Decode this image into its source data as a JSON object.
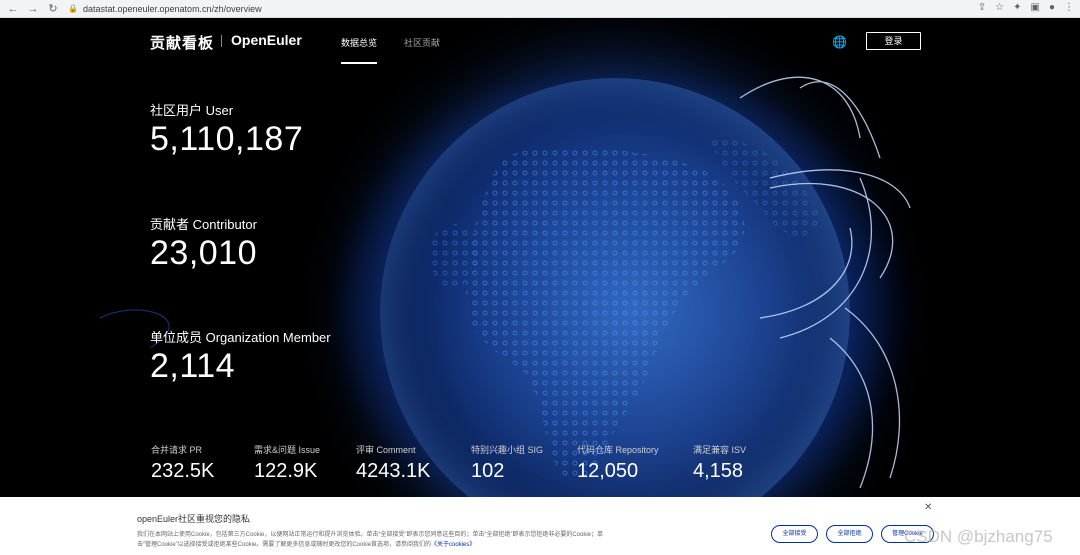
{
  "browser": {
    "back_icon": "arrow-left-icon",
    "forward_icon": "arrow-right-icon",
    "reload_icon": "reload-icon",
    "url": "datastat.openeuler.openatom.cn/zh/overview"
  },
  "header": {
    "brand_cn": "贡献看板",
    "brand_en": "OpenEuler",
    "tabs": [
      {
        "label": "数据总览",
        "active": true
      },
      {
        "label": "社区贡献",
        "active": false
      }
    ],
    "login_label": "登录"
  },
  "stats": {
    "users": {
      "label": "社区用户 User",
      "value": "5,110,187"
    },
    "contributors": {
      "label": "贡献者 Contributor",
      "value": "23,010"
    },
    "org_members": {
      "label": "单位成员 Organization Member",
      "value": "2,114"
    }
  },
  "small_stats": [
    {
      "label": "合并请求 PR",
      "value": "232.5K"
    },
    {
      "label": "需求&问题 Issue",
      "value": "122.9K"
    },
    {
      "label": "评审 Comment",
      "value": "4243.1K"
    },
    {
      "label": "特别兴趣小组 SIG",
      "value": "102"
    },
    {
      "label": "代码仓库 Repository",
      "value": "12,050"
    },
    {
      "label": "满足兼容 ISV",
      "value": "4,158"
    }
  ],
  "cookie": {
    "title": "openEuler社区重视您的隐私",
    "text": "我们在本网站上使用Cookie，包括第三方Cookie，以便网站正常运行和提升浏览体验。单击“全部接受”即表示您同意这些目的；单击“全部拒绝”即表示您拒绝非必要的Cookie；单击“管理Cookie”以选择接受或拒绝某些Cookie。需要了解更多信息或随时更改您的Cookie首选项，请参阅我们的",
    "link": "《关于cookies》",
    "buttons": [
      "全部接受",
      "全部拒绝",
      "管理Cookie"
    ]
  },
  "watermark": "CSDN @bjzhang75"
}
